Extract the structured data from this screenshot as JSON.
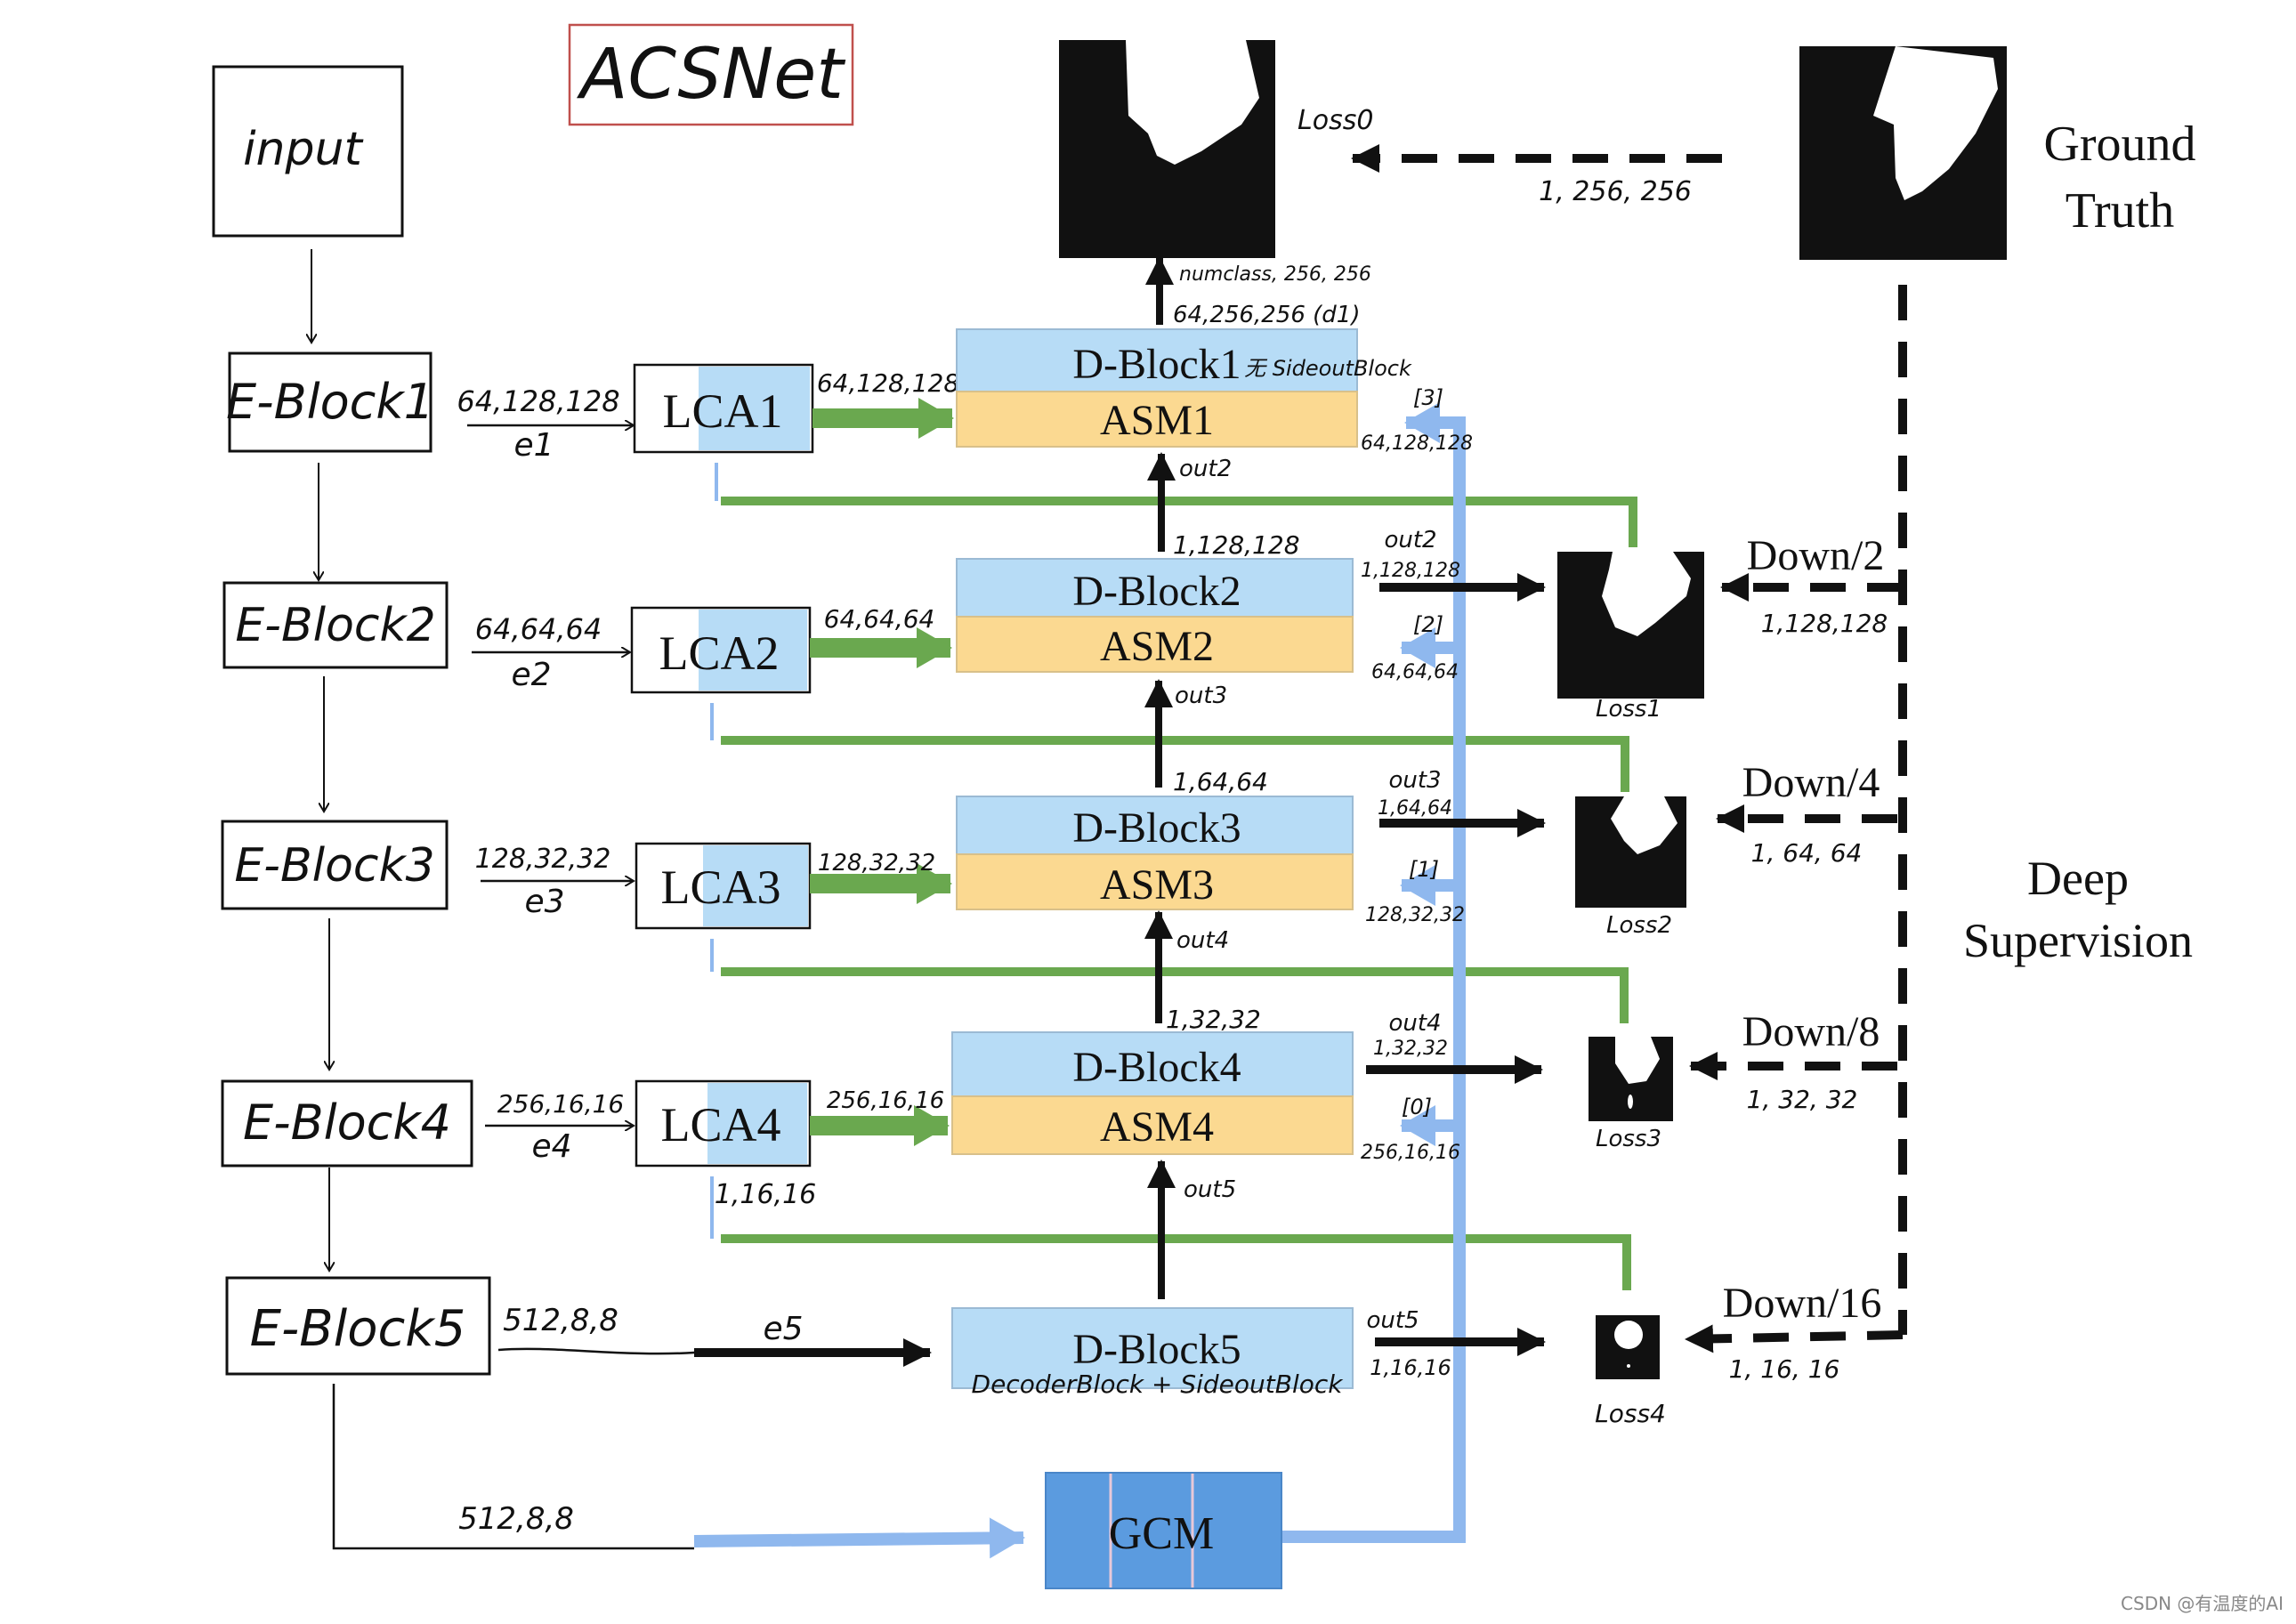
{
  "title": "ACSNet",
  "input": {
    "label": "input"
  },
  "encoder": [
    {
      "label": "E-Block1",
      "shape": "64,128,128",
      "feature": "e1"
    },
    {
      "label": "E-Block2",
      "shape": "64,64,64",
      "feature": "e2"
    },
    {
      "label": "E-Block3",
      "shape": "128,32,32",
      "feature": "e3"
    },
    {
      "label": "E-Block4",
      "shape": "256,16,16",
      "feature": "e4"
    },
    {
      "label": "E-Block5",
      "shape": "512,8,8",
      "feature": "e5"
    }
  ],
  "lca": [
    {
      "label": "LCA1",
      "out_shape": "64,128,128"
    },
    {
      "label": "LCA2",
      "out_shape": "64,64,64"
    },
    {
      "label": "LCA3",
      "out_shape": "128,32,32"
    },
    {
      "label": "LCA4",
      "out_shape": "256,16,16",
      "guide_shape": "1,16,16"
    }
  ],
  "decoder": [
    {
      "dblock": "D-Block1",
      "asm": "ASM1",
      "note": "无 SideoutBlock",
      "top_shape": "64,256,256 (d1)",
      "top_out": "numclass, 256, 256",
      "in_label": "out2",
      "gcm_index": "[3]",
      "gcm_shape": "64,128,128"
    },
    {
      "dblock": "D-Block2",
      "asm": "ASM2",
      "top_shape": "1,128,128",
      "side_label": "out2",
      "side_shape": "1,128,128",
      "in_label": "out3",
      "gcm_index": "[2]",
      "gcm_shape": "64,64,64"
    },
    {
      "dblock": "D-Block3",
      "asm": "ASM3",
      "top_shape": "1,64,64",
      "side_label": "out3",
      "side_shape": "1,64,64",
      "in_label": "out4",
      "gcm_index": "[1]",
      "gcm_shape": "128,32,32"
    },
    {
      "dblock": "D-Block4",
      "asm": "ASM4",
      "top_shape": "1,32,32",
      "side_label": "out4",
      "side_shape": "1,32,32",
      "in_label": "out5",
      "gcm_index": "[0]",
      "gcm_shape": "256,16,16"
    },
    {
      "dblock": "D-Block5",
      "sub": "DecoderBlock + SideoutBlock",
      "side_label": "out5",
      "side_shape": "1,16,16",
      "in_label": "e5"
    }
  ],
  "gcm": {
    "label": "GCM",
    "in_shape": "512,8,8"
  },
  "losses": [
    {
      "label": "Loss0",
      "gt_shape": "1, 256, 256"
    },
    {
      "label": "Loss1",
      "down": "Down/2",
      "gt_shape": "1,128,128"
    },
    {
      "label": "Loss2",
      "down": "Down/4",
      "gt_shape": "1, 64, 64"
    },
    {
      "label": "Loss3",
      "down": "Down/8",
      "gt_shape": "1, 32, 32"
    },
    {
      "label": "Loss4",
      "down": "Down/16",
      "gt_shape": "1, 16, 16"
    }
  ],
  "ground_truth": {
    "line1": "Ground",
    "line2": "Truth"
  },
  "deep_supervision": {
    "line1": "Deep",
    "line2": "Supervision"
  },
  "colors": {
    "title_red": "#c0504d",
    "dblock_blue": "#b7dcf6",
    "asm_orange": "#fbd991",
    "green_arrow": "#6aa84f",
    "gcm_blue": "#5b9bdf",
    "light_blue_line": "#8fb8ee"
  },
  "watermark": "CSDN @有温度的AI"
}
